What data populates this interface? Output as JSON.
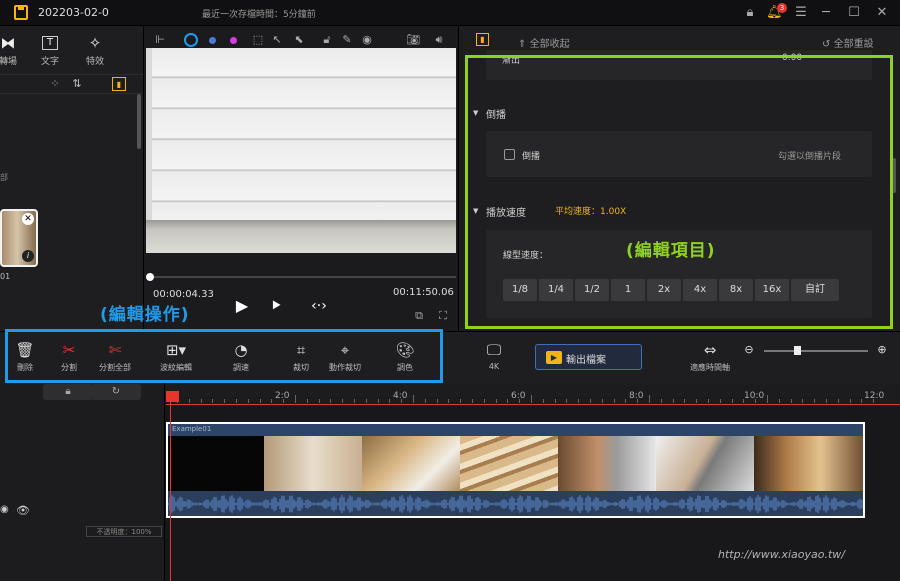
{
  "titlebar": {
    "project_name": "202203-02-0",
    "autosave": "最近一次存檔時間：5分鐘前",
    "notification_count": "3"
  },
  "left_panel": {
    "tabs": [
      {
        "label": "轉場",
        "icon": "transition-icon"
      },
      {
        "label": "文字",
        "icon": "text-icon"
      },
      {
        "label": "特效",
        "icon": "effects-icon"
      }
    ],
    "side_letter": "部",
    "media_label": "01"
  },
  "preview": {
    "current_time": "00:00:04.33",
    "total_time": "00:11:50.06",
    "colors": [
      "#1f9bea",
      "#4a7bd8",
      "#d63de6"
    ]
  },
  "properties": {
    "collapse_all": "全部收起",
    "reset_all": "全部重設",
    "fade_label": "漸出",
    "fade_value": "0.00",
    "reverse": {
      "title": "倒播",
      "checkbox_label": "倒播",
      "hint": "勾選以倒播片段"
    },
    "speed": {
      "title": "播放速度",
      "avg_label": "平均速度：",
      "avg_value": "1.00X",
      "linear_label": "線型速度：",
      "options": [
        "1/8",
        "1/4",
        "1/2",
        "1",
        "2x",
        "4x",
        "8x",
        "16x",
        "自訂"
      ]
    }
  },
  "annotations": {
    "edit_ops": "(編輯操作)",
    "edit_items": "(編輯項目)"
  },
  "edit_toolbar": {
    "items": [
      {
        "label": "刪除",
        "icon": "trash-icon"
      },
      {
        "label": "分割",
        "icon": "scissors-icon"
      },
      {
        "label": "分割全部",
        "icon": "split-all-icon"
      },
      {
        "label": "波紋編輯",
        "icon": "ripple-edit-icon"
      },
      {
        "label": "調速",
        "icon": "speedometer-icon"
      },
      {
        "label": "裁切",
        "icon": "crop-icon"
      },
      {
        "label": "動作裁切",
        "icon": "motion-crop-icon"
      },
      {
        "label": "調色",
        "icon": "palette-icon"
      }
    ],
    "format_label": "4K",
    "export_label": "輸出檔案",
    "fit_label": "適應時間軸"
  },
  "timeline": {
    "ticks": [
      "2:0",
      "4:0",
      "6:0",
      "8:0",
      "10:0",
      "12:0"
    ],
    "opacity_label": "不透明度：100%",
    "clip_name": "Example01"
  },
  "watermark": "http://www.xiaoyao.tw/",
  "accent_colors": {
    "yellow": "#f2b417",
    "red": "#e2352f",
    "annotation_blue": "#1f9bea",
    "annotation_green": "#8ed11f"
  }
}
